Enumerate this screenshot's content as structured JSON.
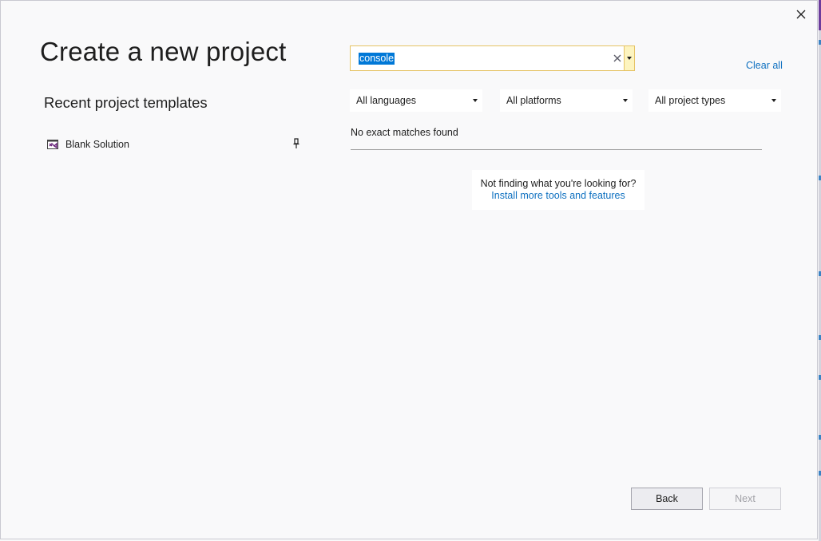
{
  "window": {
    "title": "Create a new project",
    "close_icon": "close-icon"
  },
  "recent": {
    "heading": "Recent project templates",
    "items": [
      {
        "label": "Blank Solution",
        "icon": "visual-studio-solution-icon",
        "pin_icon": "pin-icon"
      }
    ]
  },
  "search": {
    "value": "console",
    "clear_icon": "clear-x-icon",
    "dropdown_icon": "chevron-down-icon"
  },
  "clear_all_label": "Clear all",
  "filters": [
    {
      "label": "All languages"
    },
    {
      "label": "All platforms"
    },
    {
      "label": "All project types"
    }
  ],
  "results": {
    "status": "No exact matches found"
  },
  "hint": {
    "text": "Not finding what you're looking for?",
    "link": "Install more tools and features"
  },
  "footer": {
    "back_label": "Back",
    "next_label": "Next"
  },
  "colors": {
    "accent_link": "#0e70c0",
    "search_border": "#e5c365",
    "selection": "#0078d7",
    "vs_purple": "#68217a"
  }
}
